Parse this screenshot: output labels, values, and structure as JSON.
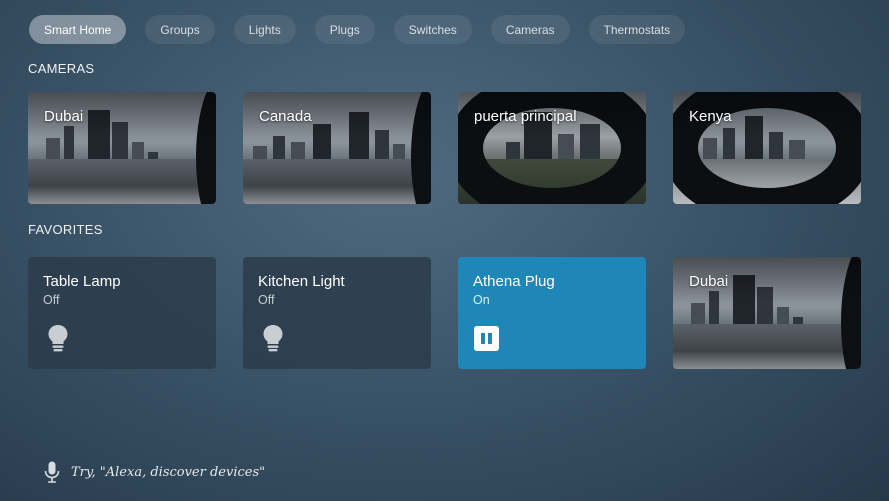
{
  "tabs": [
    {
      "label": "Smart Home",
      "active": true
    },
    {
      "label": "Groups",
      "active": false
    },
    {
      "label": "Lights",
      "active": false
    },
    {
      "label": "Plugs",
      "active": false
    },
    {
      "label": "Switches",
      "active": false
    },
    {
      "label": "Cameras",
      "active": false
    },
    {
      "label": "Thermostats",
      "active": false
    }
  ],
  "sections": {
    "cameras_title": "CAMERAS",
    "favorites_title": "FAVORITES"
  },
  "cameras": [
    {
      "label": "Dubai"
    },
    {
      "label": "Canada"
    },
    {
      "label": "puerta principal"
    },
    {
      "label": "Kenya"
    }
  ],
  "favorites": [
    {
      "name": "Table Lamp",
      "state": "Off",
      "type": "light",
      "icon": "lightbulb-icon"
    },
    {
      "name": "Kitchen Light",
      "state": "Off",
      "type": "light",
      "icon": "lightbulb-icon"
    },
    {
      "name": "Athena Plug",
      "state": "On",
      "type": "plug",
      "icon": "plug-icon"
    },
    {
      "name": "Dubai",
      "type": "camera"
    }
  ],
  "hint": {
    "text": "Try, \"Alexa, discover devices\"",
    "icon": "microphone-icon"
  },
  "colors": {
    "active_card": "#1f86b8",
    "inactive_card": "#2c3c4b"
  }
}
